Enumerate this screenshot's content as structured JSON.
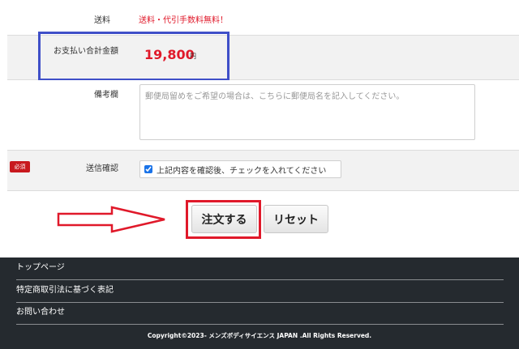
{
  "form": {
    "shipping": {
      "label": "送料",
      "value": "送料・代引手数料無料！"
    },
    "total": {
      "label": "お支払い合計金額",
      "amount": "19,800",
      "unit": "円"
    },
    "remarks": {
      "label": "備考欄",
      "placeholder": "郵便局留めをご希望の場合は、こちらに郵便局名を記入してください。"
    },
    "confirm": {
      "required_badge": "必須",
      "label": "送信確認",
      "checkbox_text": "上記内容を確認後、チェックを入れてください",
      "checked": true
    }
  },
  "actions": {
    "order_label": "注文する",
    "reset_label": "リセット"
  },
  "annotations": {
    "arrow_color": "#e0192a",
    "total_highlight_color": "#3f4fc8",
    "button_highlight_color": "#e0192a"
  },
  "footer": {
    "links": [
      "トップページ",
      "特定商取引法に基づく表記",
      "お問い合わせ"
    ],
    "copyright": "Copyright©2023- メンズボディサイエンス JAPAN .All Rights Reserved."
  }
}
